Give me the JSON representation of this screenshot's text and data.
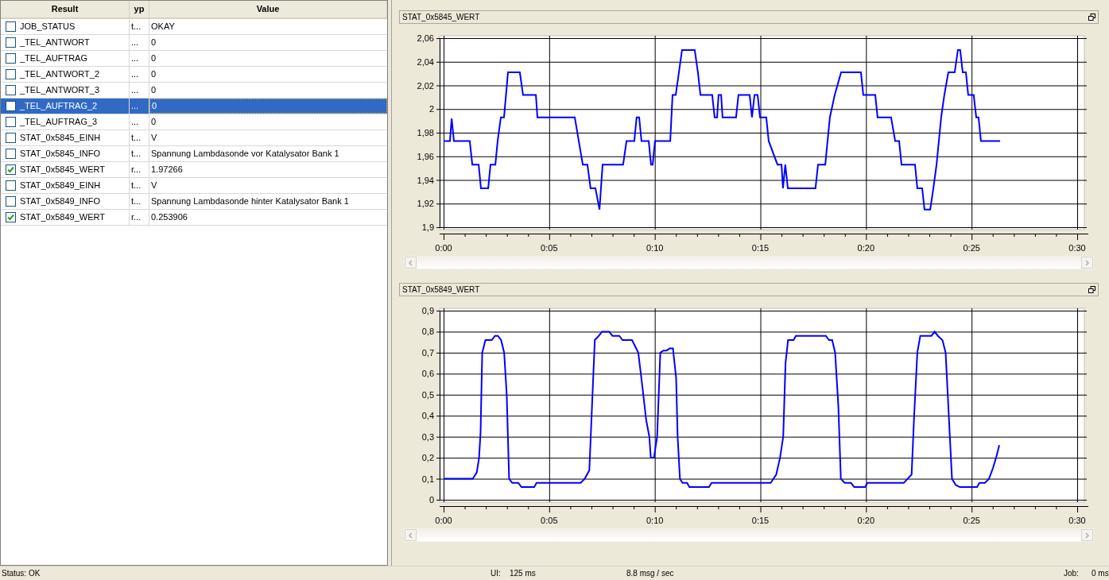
{
  "table": {
    "columns": [
      "Result",
      "yp",
      "Value"
    ],
    "rows": [
      {
        "name": "JOB_STATUS",
        "type": "t...",
        "value": "OKAY",
        "checked": false,
        "selected": false
      },
      {
        "name": "_TEL_ANTWORT",
        "type": "...",
        "value": "0",
        "checked": false,
        "selected": false
      },
      {
        "name": "_TEL_AUFTRAG",
        "type": "...",
        "value": "0",
        "checked": false,
        "selected": false
      },
      {
        "name": "_TEL_ANTWORT_2",
        "type": "...",
        "value": "0",
        "checked": false,
        "selected": false
      },
      {
        "name": "_TEL_ANTWORT_3",
        "type": "...",
        "value": "0",
        "checked": false,
        "selected": false
      },
      {
        "name": "_TEL_AUFTRAG_2",
        "type": "...",
        "value": "0",
        "checked": false,
        "selected": true
      },
      {
        "name": "_TEL_AUFTRAG_3",
        "type": "...",
        "value": "0",
        "checked": false,
        "selected": false
      },
      {
        "name": "STAT_0x5845_EINH",
        "type": "t...",
        "value": "V",
        "checked": false,
        "selected": false
      },
      {
        "name": "STAT_0x5845_INFO",
        "type": "t...",
        "value": "Spannung Lambdasonde vor Katalysator Bank 1",
        "checked": false,
        "selected": false
      },
      {
        "name": "STAT_0x5845_WERT",
        "type": "r...",
        "value": "1.97266",
        "checked": true,
        "selected": false
      },
      {
        "name": "STAT_0x5849_EINH",
        "type": "t...",
        "value": "V",
        "checked": false,
        "selected": false
      },
      {
        "name": "STAT_0x5849_INFO",
        "type": "t...",
        "value": "Spannung Lambdasonde hinter Katalysator Bank 1",
        "checked": false,
        "selected": false
      },
      {
        "name": "STAT_0x5849_WERT",
        "type": "r...",
        "value": "0.253906",
        "checked": true,
        "selected": false
      }
    ]
  },
  "charts": [
    {
      "title": "STAT_0x5845_WERT",
      "chart_data": {
        "type": "line",
        "grid": true,
        "xlim": [
          0,
          30
        ],
        "ylim": [
          1.9,
          2.06
        ],
        "xticks": [
          {
            "value": 0,
            "label": "0:00"
          },
          {
            "value": 5,
            "label": "0:05"
          },
          {
            "value": 10,
            "label": "0:10"
          },
          {
            "value": 15,
            "label": "0:15"
          },
          {
            "value": 20,
            "label": "0:20"
          },
          {
            "value": 25,
            "label": "0:25"
          },
          {
            "value": 30,
            "label": "0:30"
          }
        ],
        "yticks": [
          {
            "value": 1.9,
            "label": "1,9"
          },
          {
            "value": 1.92,
            "label": "1,92"
          },
          {
            "value": 1.94,
            "label": "1,94"
          },
          {
            "value": 1.96,
            "label": "1,96"
          },
          {
            "value": 1.98,
            "label": "1,98"
          },
          {
            "value": 2,
            "label": "2"
          },
          {
            "value": 2.02,
            "label": "2,02"
          },
          {
            "value": 2.04,
            "label": "2,04"
          },
          {
            "value": 2.06,
            "label": "2,06"
          }
        ],
        "x": [
          0,
          0.3,
          0.38,
          0.49,
          1.24,
          1.36,
          1.66,
          1.77,
          2.11,
          2.22,
          2.45,
          2.56,
          2.71,
          2.86,
          3.05,
          3.61,
          3.76,
          4.37,
          4.44,
          6.21,
          6.4,
          6.59,
          6.81,
          6.96,
          7.19,
          7.38,
          7.53,
          8.5,
          8.66,
          9.03,
          9.14,
          9.26,
          9.37,
          9.71,
          9.82,
          9.9,
          10.01,
          10.73,
          10.84,
          10.99,
          11.14,
          11.29,
          11.89,
          12.04,
          12.16,
          12.72,
          12.83,
          12.95,
          13.02,
          13.14,
          13.21,
          13.85,
          13.96,
          14.49,
          14.6,
          14.72,
          14.87,
          14.98,
          15.28,
          15.39,
          15.81,
          16,
          16.07,
          16.18,
          16.3,
          17.61,
          17.73,
          18.07,
          18.18,
          18.29,
          18.52,
          18.82,
          19.76,
          19.87,
          20.44,
          20.55,
          21.19,
          21.38,
          21.57,
          21.68,
          22.32,
          22.43,
          22.66,
          22.77,
          23.04,
          23.19,
          23.34,
          23.56,
          23.71,
          23.9,
          24.2,
          24.35,
          24.46,
          24.58,
          24.73,
          24.84,
          25.1,
          25.22,
          25.33,
          25.44,
          26.35
        ],
        "series": [
          {
            "color": "#0000ff",
            "values": [
              1.973,
              1.973,
              1.992,
              1.973,
              1.973,
              1.953,
              1.953,
              1.933,
              1.933,
              1.953,
              1.953,
              1.973,
              1.993,
              1.993,
              2.031,
              2.031,
              2.012,
              2.012,
              1.993,
              1.993,
              1.973,
              1.953,
              1.953,
              1.933,
              1.933,
              1.915,
              1.953,
              1.953,
              1.973,
              1.973,
              1.993,
              1.993,
              1.973,
              1.973,
              1.953,
              1.953,
              1.973,
              1.973,
              2.012,
              2.012,
              2.031,
              2.05,
              2.05,
              2.031,
              2.012,
              2.012,
              1.993,
              1.993,
              2.012,
              2.012,
              1.993,
              1.993,
              2.012,
              2.012,
              1.993,
              2.012,
              2.012,
              1.993,
              1.993,
              1.973,
              1.953,
              1.953,
              1.933,
              1.953,
              1.933,
              1.933,
              1.953,
              1.953,
              1.973,
              1.993,
              2.012,
              2.031,
              2.031,
              2.012,
              2.012,
              1.993,
              1.993,
              1.973,
              1.973,
              1.953,
              1.953,
              1.933,
              1.933,
              1.915,
              1.915,
              1.933,
              1.953,
              1.993,
              2.012,
              2.031,
              2.031,
              2.05,
              2.05,
              2.031,
              2.031,
              2.012,
              2.012,
              1.993,
              1.993,
              1.973,
              1.973
            ]
          }
        ]
      }
    },
    {
      "title": "STAT_0x5849_WERT",
      "chart_data": {
        "type": "line",
        "grid": true,
        "xlim": [
          0,
          30
        ],
        "ylim": [
          0,
          0.9
        ],
        "xticks": [
          {
            "value": 0,
            "label": "0:00"
          },
          {
            "value": 5,
            "label": "0:05"
          },
          {
            "value": 10,
            "label": "0:10"
          },
          {
            "value": 15,
            "label": "0:15"
          },
          {
            "value": 20,
            "label": "0:20"
          },
          {
            "value": 25,
            "label": "0:25"
          },
          {
            "value": 30,
            "label": "0:30"
          }
        ],
        "yticks": [
          {
            "value": 0,
            "label": "0"
          },
          {
            "value": 0.1,
            "label": "0,1"
          },
          {
            "value": 0.2,
            "label": "0,2"
          },
          {
            "value": 0.3,
            "label": "0,3"
          },
          {
            "value": 0.4,
            "label": "0,4"
          },
          {
            "value": 0.5,
            "label": "0,5"
          },
          {
            "value": 0.6,
            "label": "0,6"
          },
          {
            "value": 0.7,
            "label": "0,7"
          },
          {
            "value": 0.8,
            "label": "0,8"
          },
          {
            "value": 0.9,
            "label": "0,9"
          }
        ],
        "x": [
          0,
          1.38,
          1.57,
          1.68,
          1.75,
          1.83,
          1.98,
          2.28,
          2.43,
          2.57,
          2.72,
          2.87,
          2.99,
          3.1,
          3.25,
          3.54,
          3.69,
          4.29,
          4.4,
          6.49,
          6.68,
          6.9,
          7.05,
          7.16,
          7.35,
          7.5,
          7.84,
          7.99,
          8.32,
          8.47,
          8.92,
          9.22,
          9.4,
          9.59,
          9.74,
          9.81,
          9.96,
          10.11,
          10.26,
          10.41,
          10.56,
          10.71,
          10.86,
          11.01,
          11.08,
          11.19,
          11.31,
          11.53,
          11.64,
          12.57,
          12.69,
          15.49,
          15.75,
          15.93,
          16.08,
          16.19,
          16.31,
          16.57,
          16.68,
          18.1,
          18.25,
          18.4,
          18.54,
          18.69,
          18.81,
          18.99,
          19.29,
          19.44,
          19.96,
          20.07,
          21.79,
          21.97,
          22.16,
          22.28,
          22.43,
          22.57,
          23.1,
          23.25,
          23.4,
          23.62,
          23.77,
          23.92,
          24.07,
          24.25,
          24.44,
          25.26,
          25.37,
          25.63,
          25.82,
          26.01,
          26.16,
          26.31
        ],
        "series": [
          {
            "color": "#0000ff",
            "values": [
              0.1,
              0.1,
              0.13,
              0.2,
              0.32,
              0.7,
              0.76,
              0.76,
              0.78,
              0.78,
              0.76,
              0.7,
              0.5,
              0.1,
              0.08,
              0.08,
              0.06,
              0.06,
              0.08,
              0.08,
              0.1,
              0.14,
              0.5,
              0.76,
              0.78,
              0.8,
              0.8,
              0.78,
              0.78,
              0.76,
              0.76,
              0.7,
              0.55,
              0.38,
              0.3,
              0.2,
              0.2,
              0.3,
              0.7,
              0.71,
              0.71,
              0.72,
              0.72,
              0.58,
              0.3,
              0.1,
              0.08,
              0.08,
              0.06,
              0.06,
              0.08,
              0.08,
              0.12,
              0.2,
              0.3,
              0.65,
              0.76,
              0.76,
              0.78,
              0.78,
              0.76,
              0.76,
              0.7,
              0.45,
              0.1,
              0.08,
              0.08,
              0.06,
              0.06,
              0.08,
              0.08,
              0.1,
              0.12,
              0.4,
              0.7,
              0.78,
              0.78,
              0.8,
              0.78,
              0.76,
              0.7,
              0.4,
              0.1,
              0.07,
              0.06,
              0.06,
              0.08,
              0.08,
              0.1,
              0.15,
              0.2,
              0.26
            ]
          }
        ]
      }
    }
  ],
  "status_bar": {
    "status": "Status: OK",
    "ui_label": "UI:",
    "ui_value": "125 ms",
    "rate": "8.8 msg / sec",
    "job_label": "Job:",
    "job_value": "0 ms"
  }
}
